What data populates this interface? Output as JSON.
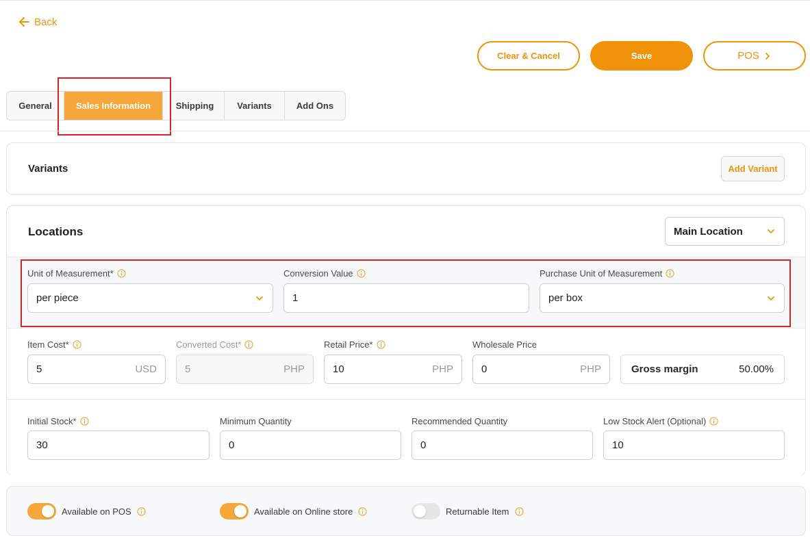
{
  "header": {
    "back_label": "Back",
    "clear_cancel_label": "Clear & Cancel",
    "save_label": "Save",
    "pos_label": "POS"
  },
  "tabs": [
    {
      "label": "General",
      "active": false
    },
    {
      "label": "Sales Information",
      "active": true
    },
    {
      "label": "Shipping",
      "active": false
    },
    {
      "label": "Variants",
      "active": false
    },
    {
      "label": "Add Ons",
      "active": false
    }
  ],
  "variants": {
    "title": "Variants",
    "add_variant_label": "Add Variant"
  },
  "locations": {
    "title": "Locations",
    "location_select": "Main Location"
  },
  "measurement": {
    "unit_label": "Unit of Measurement*",
    "unit_value": "per piece",
    "conversion_label": "Conversion Value",
    "conversion_value": "1",
    "purchase_unit_label": "Purchase Unit of Measurement",
    "purchase_unit_value": "per box"
  },
  "pricing": {
    "item_cost_label": "Item Cost*",
    "item_cost_value": "5",
    "item_cost_unit": "USD",
    "converted_cost_label": "Converted Cost*",
    "converted_cost_value": "5",
    "converted_cost_unit": "PHP",
    "retail_price_label": "Retail Price*",
    "retail_price_value": "10",
    "retail_price_unit": "PHP",
    "wholesale_price_label": "Wholesale Price",
    "wholesale_price_value": "0",
    "wholesale_price_unit": "PHP",
    "gross_margin_label": "Gross margin",
    "gross_margin_value": "50.00%"
  },
  "stock": {
    "initial_stock_label": "Initial Stock*",
    "initial_stock_value": "30",
    "min_qty_label": "Minimum Quantity",
    "min_qty_value": "0",
    "rec_qty_label": "Recommended Quantity",
    "rec_qty_value": "0",
    "low_stock_label": "Low Stock Alert (Optional)",
    "low_stock_value": "10"
  },
  "availability": {
    "pos_label": "Available on POS",
    "pos_on": true,
    "online_label": "Available on Online store",
    "online_on": true,
    "returnable_label": "Returnable Item",
    "returnable_on": false
  },
  "colors": {
    "accent": "#f0920a",
    "tab_active": "#f5a73a",
    "highlight": "#d8222a"
  }
}
